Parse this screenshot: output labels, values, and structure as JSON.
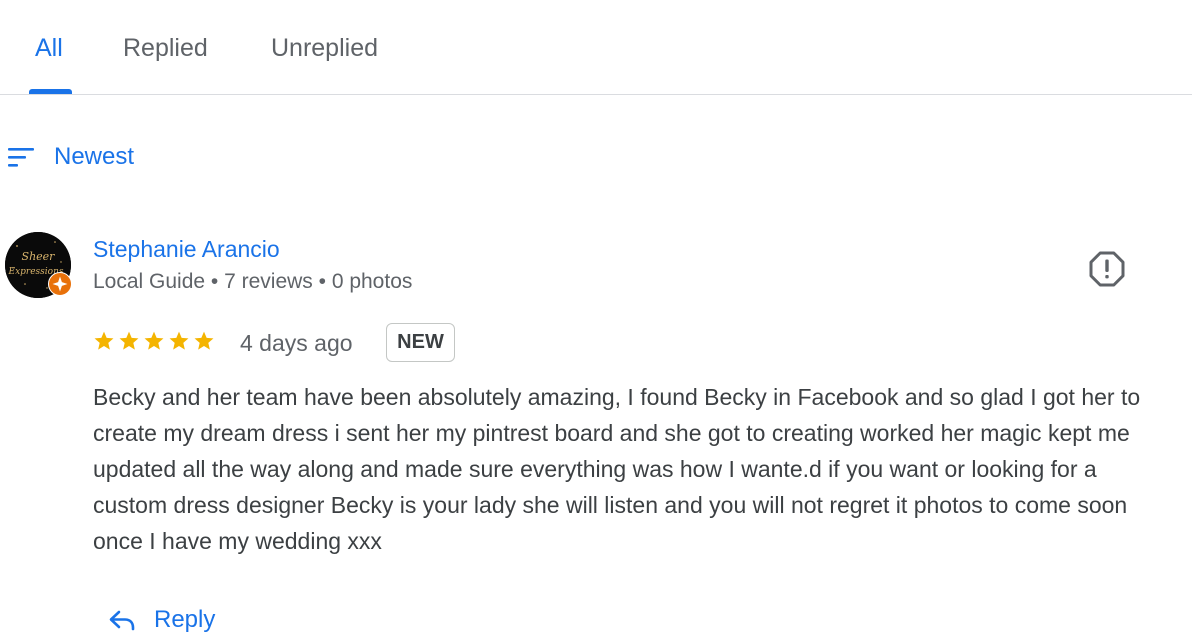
{
  "tabs": [
    {
      "label": "All",
      "active": true
    },
    {
      "label": "Replied",
      "active": false
    },
    {
      "label": "Unreplied",
      "active": false
    }
  ],
  "sort": {
    "label": "Newest",
    "icon": "sort-icon"
  },
  "review": {
    "reviewer_name": "Stephanie Arancio",
    "reviewer_meta": "Local Guide • 7 reviews • 0 photos",
    "avatar_text": "Sheer Expressions",
    "rating": 5,
    "max_rating": 5,
    "date": "4 days ago",
    "badge": "NEW",
    "text": "Becky and her team have been absolutely amazing, I found Becky in Facebook and so glad I got her to create my dream dress i sent her my pintrest board and she got to creating worked her magic kept me updated all the way along and made sure everything was how I wante.d if you want or looking for a custom dress designer Becky is your lady she will listen and you will not regret it photos to come soon once I have my wedding xxx"
  },
  "actions": {
    "reply_label": "Reply",
    "report_icon": "report-icon"
  },
  "colors": {
    "accent": "#1a73e8",
    "star": "#f4b400",
    "text": "#3c4043",
    "muted": "#5f6368",
    "local_guide_badge": "#e8710a"
  }
}
